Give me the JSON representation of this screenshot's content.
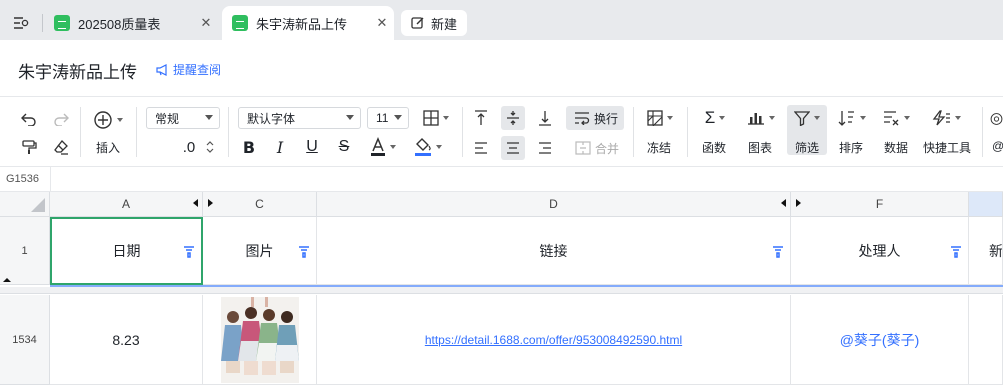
{
  "tabs": [
    {
      "label": "202508质量表",
      "active": false
    },
    {
      "label": "朱宇涛新品上传",
      "active": true
    }
  ],
  "new_tab_label": "新建",
  "doc": {
    "title": "朱宇涛新品上传",
    "remind_label": "提醒查阅"
  },
  "toolbar": {
    "insert_label": "插入",
    "format_value": "常规",
    "decimal_label": ".0",
    "font_value": "默认字体",
    "size_value": "11",
    "wrap_label": "换行",
    "merge_label": "合并",
    "freeze_label": "冻结",
    "function_label": "函数",
    "chart_label": "图表",
    "filter_label": "筛选",
    "sort_label": "排序",
    "data_label": "数据",
    "quicktools_label": "快捷工具",
    "overflow_label": "@"
  },
  "name_box": "G1536",
  "columns": [
    {
      "letter": "A",
      "header": "日期"
    },
    {
      "letter": "C",
      "header": "图片"
    },
    {
      "letter": "D",
      "header": "链接"
    },
    {
      "letter": "F",
      "header": "处理人"
    },
    {
      "letter": "",
      "header": "新"
    }
  ],
  "header_row_number": "1",
  "rows": [
    {
      "row_number": "1534",
      "date": "8.23",
      "link": "https://detail.1688.com/offer/953008492590.html",
      "handler": "@葵子(葵子)"
    }
  ],
  "colors": {
    "accent": "#3370ff",
    "sheet_green": "#2fbe5f",
    "selection": "#2fa56b"
  }
}
